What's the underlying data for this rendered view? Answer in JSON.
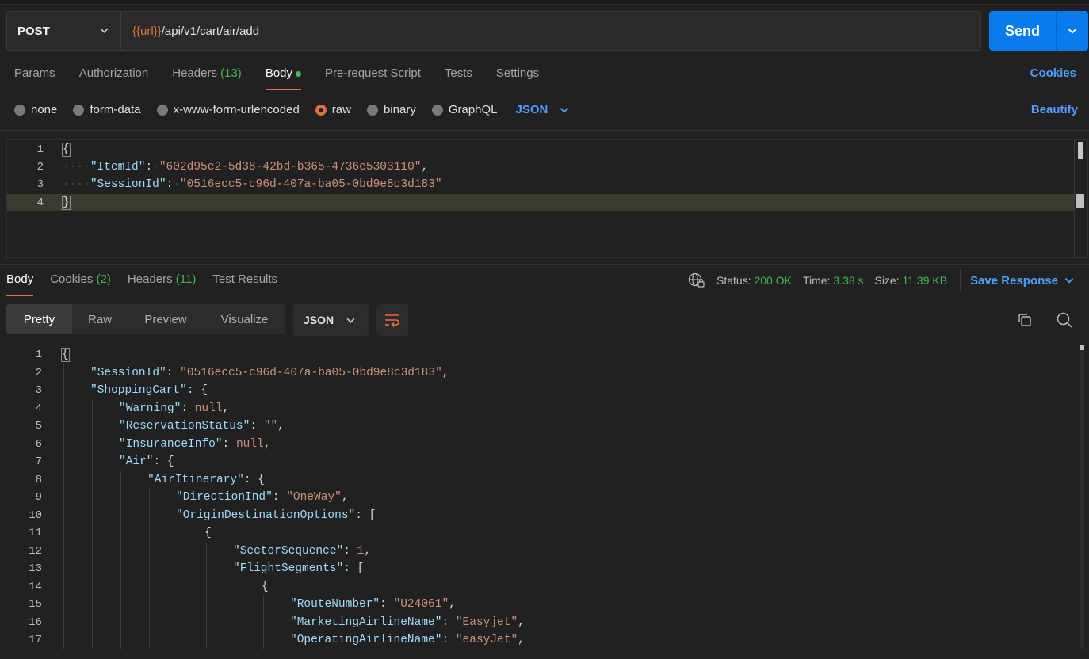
{
  "request": {
    "method": "POST",
    "url_var": "{{url}}",
    "url_path": "/api/v1/cart/air/add",
    "send_label": "Send"
  },
  "request_tabs": {
    "params": "Params",
    "authorization": "Authorization",
    "headers": "Headers",
    "headers_count": "(13)",
    "body": "Body",
    "prerequest": "Pre-request Script",
    "tests": "Tests",
    "settings": "Settings",
    "cookies": "Cookies"
  },
  "body_options": {
    "none": "none",
    "form_data": "form-data",
    "urlencoded": "x-www-form-urlencoded",
    "raw": "raw",
    "binary": "binary",
    "graphql": "GraphQL",
    "format": "JSON",
    "beautify": "Beautify"
  },
  "request_body": {
    "line_numbers": [
      "1",
      "2",
      "3",
      "4"
    ],
    "open_brace": "{",
    "close_brace": "}",
    "item_key": "\"ItemId\"",
    "item_value": "\"602d95e2-5d38-42bd-b365-4736e5303110\"",
    "session_key": "\"SessionId\"",
    "session_value": "\"0516ecc5-c96d-407a-ba05-0bd9e8c3d183\""
  },
  "response_tabs": {
    "body": "Body",
    "cookies": "Cookies",
    "cookies_count": "(2)",
    "headers": "Headers",
    "headers_count": "(11)",
    "test_results": "Test Results"
  },
  "response_meta": {
    "status_label": "Status:",
    "status_value": "200 OK",
    "time_label": "Time:",
    "time_value": "3.38 s",
    "size_label": "Size:",
    "size_value": "11.39 KB",
    "save_label": "Save Response"
  },
  "view_modes": {
    "pretty": "Pretty",
    "raw": "Raw",
    "preview": "Preview",
    "visualize": "Visualize",
    "format": "JSON"
  },
  "response_body": {
    "lines": [
      {
        "n": "1",
        "indent": 0,
        "key": "",
        "value": "{",
        "vtype": "p",
        "suffix": ""
      },
      {
        "n": "2",
        "indent": 1,
        "key": "\"SessionId\"",
        "value": "\"0516ecc5-c96d-407a-ba05-0bd9e8c3d183\"",
        "vtype": "s",
        "suffix": ","
      },
      {
        "n": "3",
        "indent": 1,
        "key": "\"ShoppingCart\"",
        "value": "{",
        "vtype": "p",
        "suffix": ""
      },
      {
        "n": "4",
        "indent": 2,
        "key": "\"Warning\"",
        "value": "null",
        "vtype": "s",
        "suffix": ","
      },
      {
        "n": "5",
        "indent": 2,
        "key": "\"ReservationStatus\"",
        "value": "\"\"",
        "vtype": "s",
        "suffix": ","
      },
      {
        "n": "6",
        "indent": 2,
        "key": "\"InsuranceInfo\"",
        "value": "null",
        "vtype": "s",
        "suffix": ","
      },
      {
        "n": "7",
        "indent": 2,
        "key": "\"Air\"",
        "value": "{",
        "vtype": "p",
        "suffix": ""
      },
      {
        "n": "8",
        "indent": 3,
        "key": "\"AirItinerary\"",
        "value": "{",
        "vtype": "p",
        "suffix": ""
      },
      {
        "n": "9",
        "indent": 4,
        "key": "\"DirectionInd\"",
        "value": "\"OneWay\"",
        "vtype": "s",
        "suffix": ","
      },
      {
        "n": "10",
        "indent": 4,
        "key": "\"OriginDestinationOptions\"",
        "value": "[",
        "vtype": "p",
        "suffix": ""
      },
      {
        "n": "11",
        "indent": 5,
        "key": "",
        "value": "{",
        "vtype": "p",
        "suffix": ""
      },
      {
        "n": "12",
        "indent": 6,
        "key": "\"SectorSequence\"",
        "value": "1",
        "vtype": "s",
        "suffix": ","
      },
      {
        "n": "13",
        "indent": 6,
        "key": "\"FlightSegments\"",
        "value": "[",
        "vtype": "p",
        "suffix": ""
      },
      {
        "n": "14",
        "indent": 7,
        "key": "",
        "value": "{",
        "vtype": "p",
        "suffix": ""
      },
      {
        "n": "15",
        "indent": 8,
        "key": "\"RouteNumber\"",
        "value": "\"U24061\"",
        "vtype": "s",
        "suffix": ","
      },
      {
        "n": "16",
        "indent": 8,
        "key": "\"MarketingAirlineName\"",
        "value": "\"Easyjet\"",
        "vtype": "s",
        "suffix": ","
      },
      {
        "n": "17",
        "indent": 8,
        "key": "\"OperatingAirlineName\"",
        "value": "\"easyJet\"",
        "vtype": "s",
        "suffix": ","
      }
    ]
  }
}
